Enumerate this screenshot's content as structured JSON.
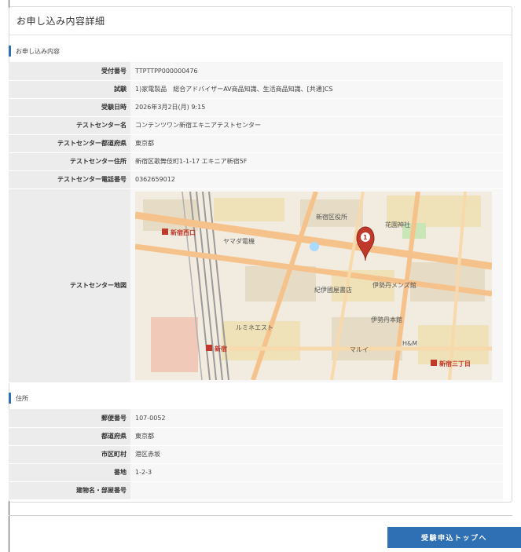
{
  "page": {
    "title": "お申し込み内容詳細"
  },
  "application": {
    "section_label": "お申し込み内容",
    "rows": [
      {
        "label": "受付番号",
        "value": "TTPTTPP000000476"
      },
      {
        "label": "試験",
        "value": "1)家電製品　総合アドバイザーAV商品知識、生活商品知識、[共通]CS"
      },
      {
        "label": "受験日時",
        "value": "2026年3月2日(月) 9:15"
      },
      {
        "label": "テストセンター名",
        "value": "コンテンツワン新宿エキニアテストセンター"
      },
      {
        "label": "テストセンター都道府県",
        "value": "東京都"
      },
      {
        "label": "テストセンター住所",
        "value": "新宿区歌舞伎町1-1-17 エキニア新宿5F"
      },
      {
        "label": "テストセンター電話番号",
        "value": "0362659012"
      }
    ],
    "map_label": "テストセンター地図"
  },
  "map": {
    "stations": [
      "新宿西口",
      "新宿",
      "新宿三丁目"
    ],
    "landmarks": [
      "新宿区役所",
      "花園神社",
      "紀伊國屋書店",
      "伊勢丹メンズ館",
      "伊勢丹本館",
      "ヤマダ電機",
      "ルミネエスト",
      "マルイ",
      "H&M"
    ],
    "marker_number": "1",
    "colors": {
      "marker": "#c0392b",
      "station": "#c0392b",
      "road": "#f6c28b",
      "park": "#c9e6b7",
      "water": "#aadaff"
    }
  },
  "address": {
    "section_label": "住所",
    "rows": [
      {
        "label": "郵便番号",
        "value": "107-0052"
      },
      {
        "label": "都道府県",
        "value": "東京都"
      },
      {
        "label": "市区町村",
        "value": "港区赤坂"
      },
      {
        "label": "番地",
        "value": "1-2-3"
      },
      {
        "label": "建物名・部屋番号",
        "value": ""
      }
    ]
  },
  "actions": {
    "top_button": "受験申込トップへ"
  },
  "colors": {
    "accent": "#2f6fb3",
    "label_bg": "#ececec",
    "value_bg": "#f7f7f7"
  }
}
